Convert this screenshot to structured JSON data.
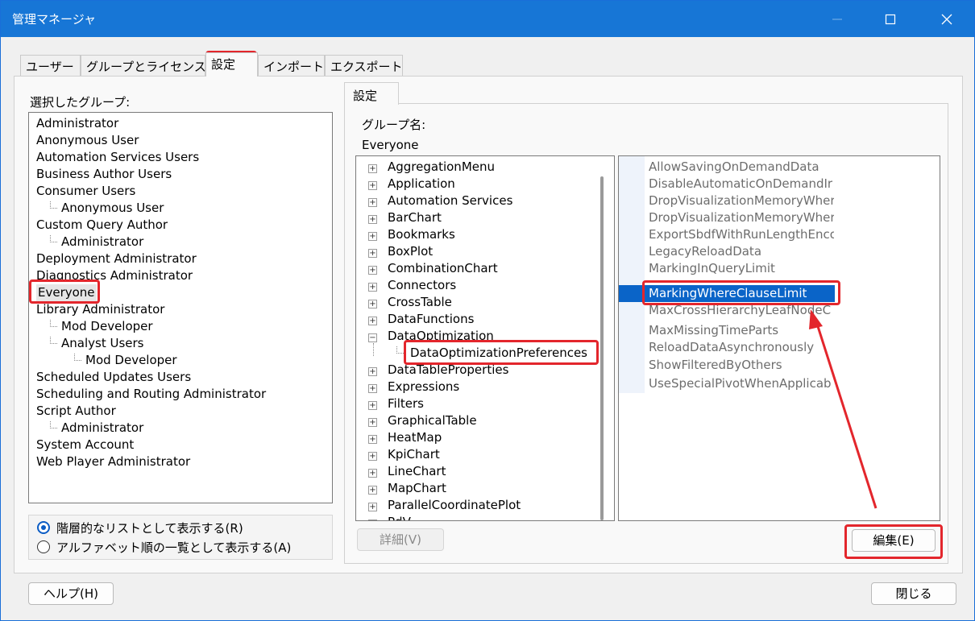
{
  "window": {
    "title": "管理マネージャ"
  },
  "tabs": [
    {
      "label": "ユーザー"
    },
    {
      "label": "グループとライセンス"
    },
    {
      "label": "設定"
    },
    {
      "label": "インポート"
    },
    {
      "label": "エクスポート"
    }
  ],
  "left": {
    "heading": "選択したグループ:",
    "groups": [
      {
        "label": "Administrator",
        "indent": 0
      },
      {
        "label": "Anonymous User",
        "indent": 0
      },
      {
        "label": "Automation Services Users",
        "indent": 0
      },
      {
        "label": "Business Author Users",
        "indent": 0
      },
      {
        "label": "Consumer Users",
        "indent": 0
      },
      {
        "label": "Anonymous User",
        "indent": 1
      },
      {
        "label": "Custom Query Author",
        "indent": 0
      },
      {
        "label": "Administrator",
        "indent": 1
      },
      {
        "label": "Deployment Administrator",
        "indent": 0
      },
      {
        "label": "Diagnostics Administrator",
        "indent": 0
      },
      {
        "label": "Everyone",
        "indent": 0,
        "selected": true
      },
      {
        "label": "Library Administrator",
        "indent": 0
      },
      {
        "label": "Mod Developer",
        "indent": 1
      },
      {
        "label": "Analyst Users",
        "indent": 1
      },
      {
        "label": "Mod Developer",
        "indent": 2
      },
      {
        "label": "Scheduled Updates Users",
        "indent": 0
      },
      {
        "label": "Scheduling and Routing Administrator",
        "indent": 0
      },
      {
        "label": "Script Author",
        "indent": 0
      },
      {
        "label": "Administrator",
        "indent": 1
      },
      {
        "label": "System Account",
        "indent": 0
      },
      {
        "label": "Web Player Administrator",
        "indent": 0
      }
    ],
    "radio_hierarchical": "階層的なリストとして表示する(R)",
    "radio_alphabetical": "アルファベット順の一覧として表示する(A)",
    "radio_selected": "hierarchical"
  },
  "settings": {
    "tab_label": "設定",
    "group_name_label": "グループ名:",
    "group_name_value": "Everyone",
    "categories": [
      {
        "label": "AggregationMenu",
        "expander": "+"
      },
      {
        "label": "Application",
        "expander": "+"
      },
      {
        "label": "Automation Services",
        "expander": "+"
      },
      {
        "label": "BarChart",
        "expander": "+"
      },
      {
        "label": "Bookmarks",
        "expander": "+"
      },
      {
        "label": "BoxPlot",
        "expander": "+"
      },
      {
        "label": "CombinationChart",
        "expander": "+"
      },
      {
        "label": "Connectors",
        "expander": "+"
      },
      {
        "label": "CrossTable",
        "expander": "+"
      },
      {
        "label": "DataFunctions",
        "expander": "+"
      },
      {
        "label": "DataOptimization",
        "expander": "-"
      },
      {
        "label": "DataOptimizationPreferences",
        "expander": "",
        "child": true,
        "selected": true
      },
      {
        "label": "DataTableProperties",
        "expander": "+"
      },
      {
        "label": "Expressions",
        "expander": "+"
      },
      {
        "label": "Filters",
        "expander": "+"
      },
      {
        "label": "GraphicalTable",
        "expander": "+"
      },
      {
        "label": "HeatMap",
        "expander": "+"
      },
      {
        "label": "KpiChart",
        "expander": "+"
      },
      {
        "label": "LineChart",
        "expander": "+"
      },
      {
        "label": "MapChart",
        "expander": "+"
      },
      {
        "label": "ParallelCoordinatePlot",
        "expander": "+"
      },
      {
        "label": "PdV",
        "expander": "+"
      }
    ],
    "properties": [
      {
        "name": "AllowSavingOnDemandData"
      },
      {
        "name": "DisableAutomaticOnDemandIr"
      },
      {
        "name": "DropVisualizationMemoryWher"
      },
      {
        "name": "DropVisualizationMemoryWher"
      },
      {
        "name": "ExportSbdfWithRunLengthEnco"
      },
      {
        "name": "LegacyReloadData"
      },
      {
        "name": "MarkingInQueryLimit"
      },
      {
        "name": "MarkingWhereClauseLimit",
        "selected": true
      },
      {
        "name": "MaxCrossHierarchyLeafNodeC"
      },
      {
        "name": "MaxMissingTimeParts"
      },
      {
        "name": "ReloadDataAsynchronously"
      },
      {
        "name": "ShowFilteredByOthers"
      },
      {
        "name": "UseSpecialPivotWhenApplicab"
      }
    ],
    "details_button": "詳細(V)",
    "edit_button": "編集(E)"
  },
  "footer": {
    "help_button": "ヘルプ(H)",
    "close_button": "閉じる"
  },
  "colors": {
    "titlebar": "#1776d6",
    "selection": "#0a64c8",
    "highlight": "#e3262c"
  }
}
